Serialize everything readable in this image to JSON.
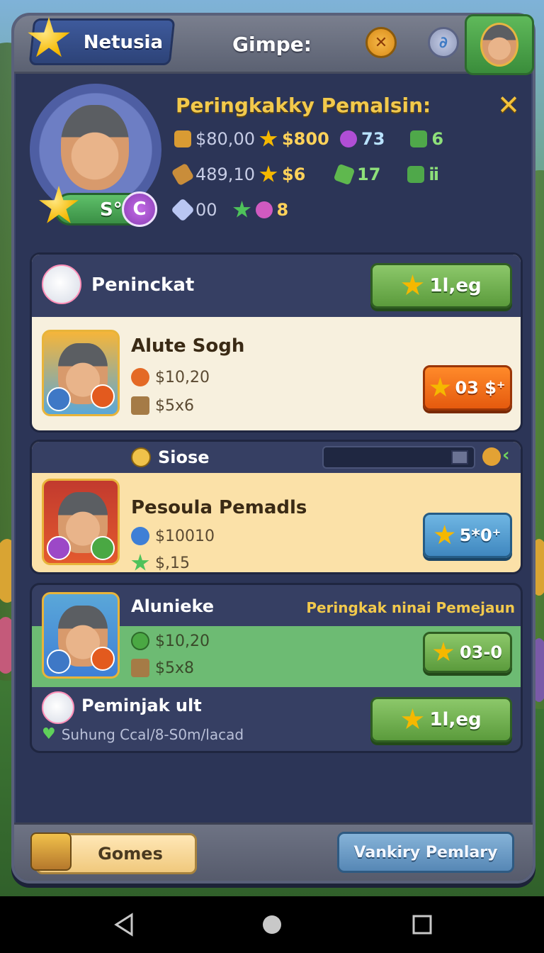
{
  "header": {
    "player_name": "Netusia",
    "title": "Gimpe:"
  },
  "profile": {
    "level_text": "S°0",
    "rank_badge": "C",
    "stats_title": "Peringkakky Pemalsin:",
    "stats": [
      {
        "a": "$80,00",
        "b": "$800",
        "c": "73",
        "d": "6"
      },
      {
        "a": "489,10",
        "b": "$6",
        "c": "17",
        "d": "ⅱ"
      },
      {
        "a": "00",
        "b": "8"
      }
    ]
  },
  "section1": {
    "label": "Peninckat",
    "button": "1l,eg"
  },
  "player1": {
    "name": "Alute Sogh",
    "line1": "$10,20",
    "line2": "$5x6",
    "button": "03 $⁺"
  },
  "section2": {
    "label": "Siose"
  },
  "player2": {
    "name": "Pesoula Pemadls",
    "line1": "$10010",
    "line2": "$,15",
    "button": "5*0⁺"
  },
  "player3": {
    "name": "Alunieke",
    "tag": "Peringkak ninai Pemejaun",
    "line1": "$10,20",
    "line2": "$5x8",
    "button": "03-0"
  },
  "section3": {
    "label": "Peminjak ult",
    "sub": "Suhung Ccal/8-S0m/lacad",
    "button": "1l,eg"
  },
  "footer": {
    "left_button": "Gomes",
    "right_button": "Vankiry Pemlary"
  },
  "colors": {
    "panel": "#2c3557",
    "gold": "#f2c94c",
    "green_button": "#6fae4e",
    "orange_button": "#f06c1a",
    "blue_button": "#4f9ad0"
  }
}
